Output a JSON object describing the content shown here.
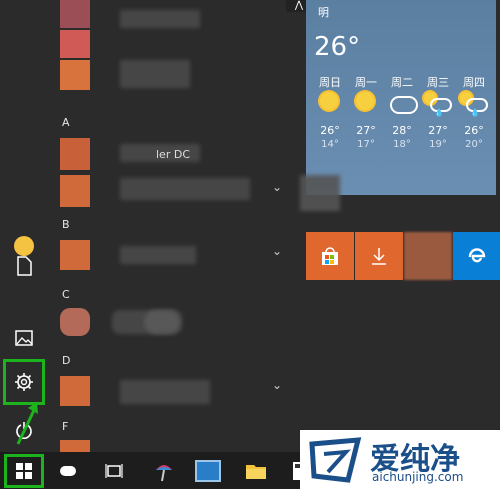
{
  "app_list": {
    "letters": [
      "A",
      "B",
      "C",
      "D",
      "F"
    ],
    "partial_label": "ler DC"
  },
  "weather": {
    "city_partial": "明",
    "current_temp": "26°",
    "days": [
      {
        "label": "周日",
        "icon": "sun-icon",
        "hi": "26°",
        "lo": "14°"
      },
      {
        "label": "周一",
        "icon": "sun-icon",
        "hi": "27°",
        "lo": "17°"
      },
      {
        "label": "周二",
        "icon": "cloud-icon",
        "hi": "28°",
        "lo": "18°"
      },
      {
        "label": "周三",
        "icon": "cloud-rain-icon",
        "hi": "27°",
        "lo": "19°"
      },
      {
        "label": "周四",
        "icon": "cloud-rain-icon",
        "hi": "26°",
        "lo": "20°"
      }
    ]
  },
  "tiles": {
    "store_color": "#e8692a",
    "download_color": "#e8692a",
    "edge_color": "#0a7fd6"
  },
  "watermark": {
    "text": "爱纯净",
    "url": "aichunjing.com"
  },
  "colors": {
    "highlight": "#1db31d",
    "tile_orange": "#e0672e"
  }
}
